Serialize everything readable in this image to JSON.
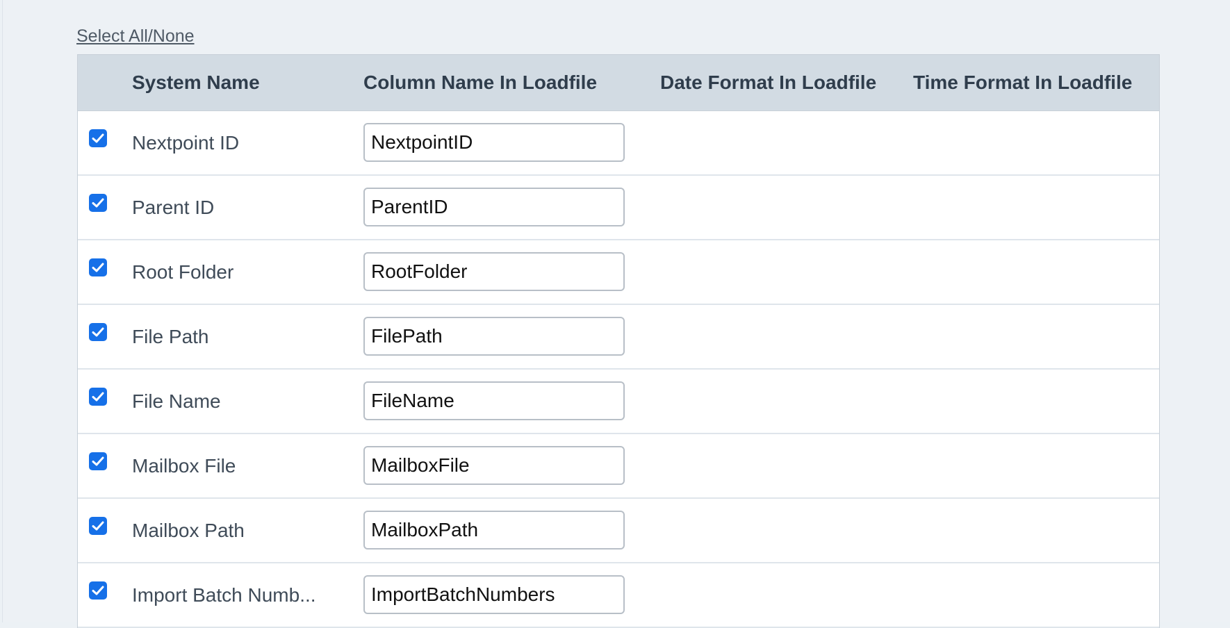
{
  "select_all_label": "Select All/None",
  "columns": {
    "system_name": "System Name",
    "column_name": "Column Name In Loadfile",
    "date_format": "Date Format In Loadfile",
    "time_format": "Time Format In Loadfile"
  },
  "rows": [
    {
      "checked": true,
      "system_name": "Nextpoint ID",
      "column_name": "NextpointID"
    },
    {
      "checked": true,
      "system_name": "Parent ID",
      "column_name": "ParentID"
    },
    {
      "checked": true,
      "system_name": "Root Folder",
      "column_name": "RootFolder"
    },
    {
      "checked": true,
      "system_name": "File Path",
      "column_name": "FilePath"
    },
    {
      "checked": true,
      "system_name": "File Name",
      "column_name": "FileName"
    },
    {
      "checked": true,
      "system_name": "Mailbox File",
      "column_name": "MailboxFile"
    },
    {
      "checked": true,
      "system_name": "Mailbox Path",
      "column_name": "MailboxPath"
    },
    {
      "checked": true,
      "system_name": "Import Batch Numb...",
      "column_name": "ImportBatchNumbers"
    }
  ],
  "colors": {
    "checkbox": "#1670e8",
    "header_bg": "#d2dbe3",
    "page_bg": "#edf1f5"
  }
}
